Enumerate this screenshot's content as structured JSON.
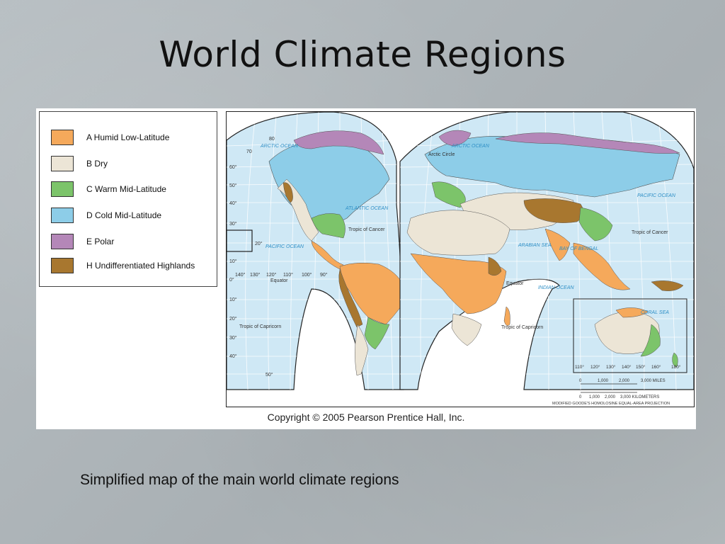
{
  "slide": {
    "title": "World Climate Regions",
    "caption": "Simplified map of the main world climate regions"
  },
  "legend": {
    "items": [
      {
        "code": "A",
        "label": "A  Humid Low-Latitude",
        "color": "#f5a95b"
      },
      {
        "code": "B",
        "label": "B  Dry",
        "color": "#ece5d6"
      },
      {
        "code": "C",
        "label": "C  Warm Mid-Latitude",
        "color": "#7cc46a"
      },
      {
        "code": "D",
        "label": "D  Cold Mid-Latitude",
        "color": "#8dcde8"
      },
      {
        "code": "E",
        "label": "E  Polar",
        "color": "#b487b8"
      },
      {
        "code": "H",
        "label": "H  Undifferentiated Highlands",
        "color": "#a8772f"
      }
    ]
  },
  "map": {
    "ocean_color": "#cfe8f5",
    "labels": {
      "arctic_ocean_left": "ARCTIC OCEAN",
      "arctic_ocean_right": "ARCTIC OCEAN",
      "arctic_circle": "Arctic Circle",
      "atlantic_ocean": "ATLANTIC OCEAN",
      "pacific_ocean_left": "PACIFIC OCEAN",
      "pacific_ocean_right": "PACIFIC OCEAN",
      "indian_ocean": "INDIAN OCEAN",
      "arabian_sea": "ARABIAN SEA",
      "bay_of_bengal": "BAY OF BENGAL",
      "coral_sea": "CORAL SEA",
      "tropic_of_cancer_left": "Tropic of Cancer",
      "tropic_of_cancer_right": "Tropic of Cancer",
      "tropic_of_capricorn_left": "Tropic of Capricorn",
      "tropic_of_capricorn_right": "Tropic of Capricorn",
      "equator_left": "Equator",
      "equator_right": "Equator"
    },
    "scale": {
      "miles_ticks": [
        "0",
        "1,000",
        "2,000",
        "3,000 MILES"
      ],
      "km_ticks": [
        "0",
        "1,000",
        "2,000",
        "3,000 KILOMETERS"
      ],
      "projection": "MODIFIED GOODE'S HOMOLOSINE EQUAL-AREA PROJECTION"
    },
    "left_lat_ticks": [
      "80",
      "70",
      "60°",
      "50°",
      "40°",
      "30°",
      "20°",
      "10°",
      "0°",
      "10°",
      "20°",
      "30°",
      "40°",
      "50°"
    ],
    "left_lon_ticks": [
      "140°",
      "130°",
      "120°",
      "110°",
      "100°",
      "90°"
    ],
    "inset_lon_ticks": [
      "110°",
      "120°",
      "130°",
      "140°",
      "150°",
      "160°",
      "180°"
    ]
  },
  "copyright": "Copyright © 2005 Pearson Prentice Hall, Inc."
}
